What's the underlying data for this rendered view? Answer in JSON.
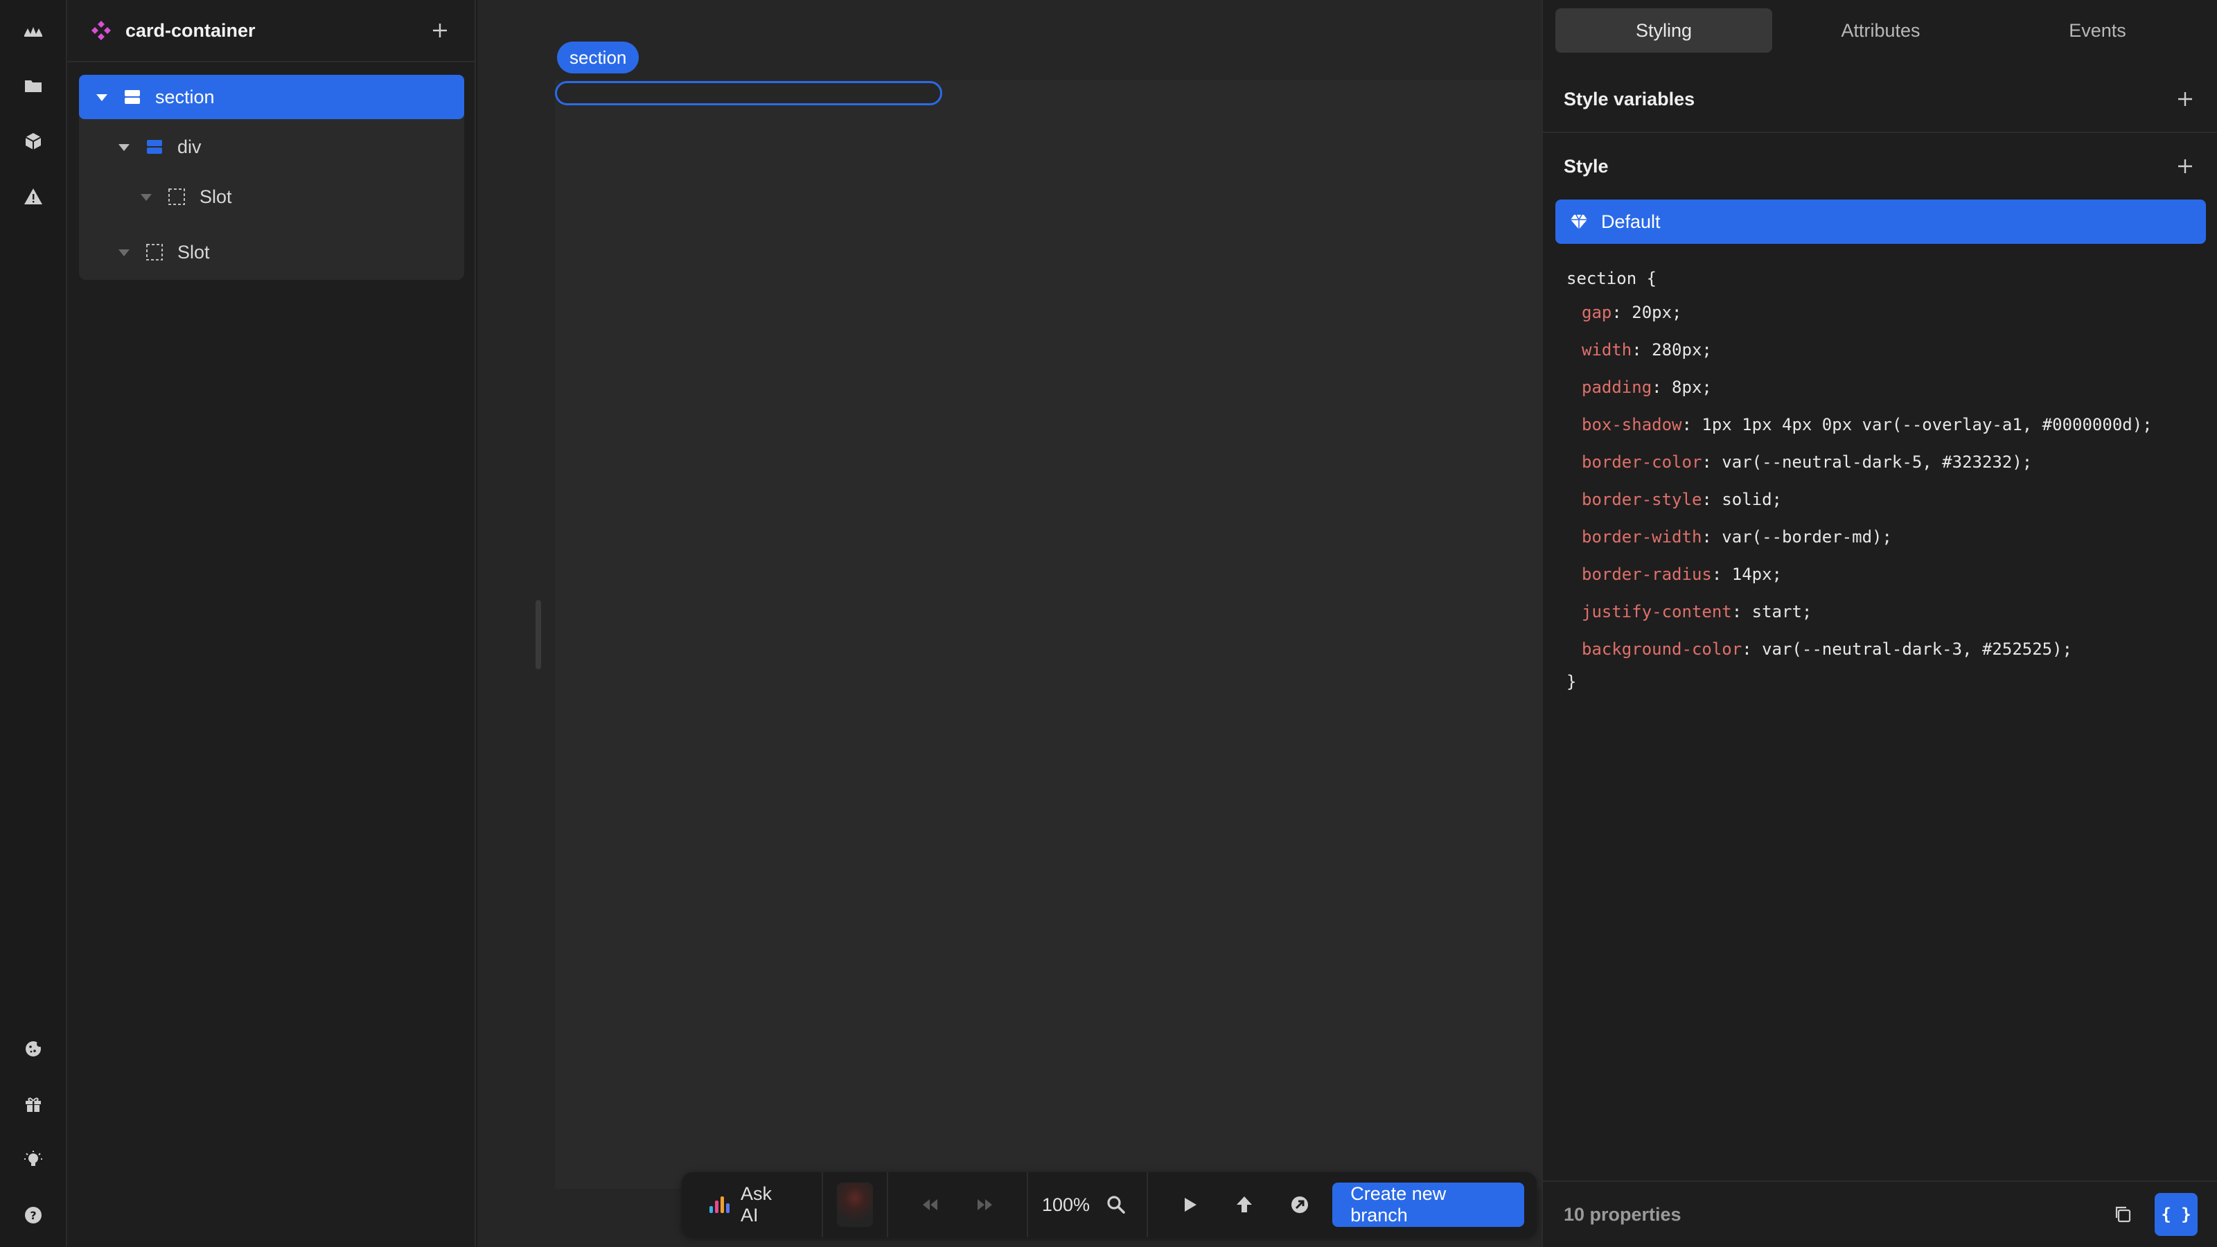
{
  "rail": {
    "top_items": [
      "logo-icon",
      "folder-icon",
      "box-icon",
      "warning-icon"
    ],
    "bottom_items": [
      "cookie-icon",
      "gift-icon",
      "bulb-icon",
      "help-icon"
    ]
  },
  "layers": {
    "title": "card-container",
    "tree": [
      {
        "label": "section",
        "icon": "container-icon",
        "selected": true
      },
      {
        "label": "div",
        "icon": "container-icon",
        "selected": false
      },
      {
        "label": "Slot",
        "icon": "slot-icon",
        "selected": false
      },
      {
        "label": "Slot",
        "icon": "slot-icon",
        "selected": false
      }
    ]
  },
  "canvas": {
    "selected_tag": "section"
  },
  "toolbar": {
    "ask_ai": "Ask AI",
    "zoom": "100%",
    "create_branch": "Create new branch"
  },
  "props": {
    "tabs": [
      "Styling",
      "Attributes",
      "Events"
    ],
    "active_tab": "Styling",
    "style_variables_title": "Style variables",
    "style_title": "Style",
    "variant_label": "Default",
    "selector_open": "section {",
    "declarations": [
      {
        "name": "gap",
        "value": ": 20px;"
      },
      {
        "name": "width",
        "value": ": 280px;"
      },
      {
        "name": "padding",
        "value": ": 8px;"
      },
      {
        "name": "box-shadow",
        "value": ": 1px 1px 4px 0px var(--overlay-a1, #0000000d);"
      },
      {
        "name": "border-color",
        "value": ": var(--neutral-dark-5, #323232);"
      },
      {
        "name": "border-style",
        "value": ": solid;"
      },
      {
        "name": "border-width",
        "value": ": var(--border-md);"
      },
      {
        "name": "border-radius",
        "value": ": 14px;"
      },
      {
        "name": "justify-content",
        "value": ": start;"
      },
      {
        "name": "background-color",
        "value": ": var(--neutral-dark-3, #252525);"
      }
    ],
    "selector_close": "}",
    "footer_count": "10 properties",
    "code_button": "{ }"
  },
  "colors": {
    "accent": "#2a6ae8",
    "property_name": "#e0706a",
    "component_icon": "#d84fd6"
  }
}
